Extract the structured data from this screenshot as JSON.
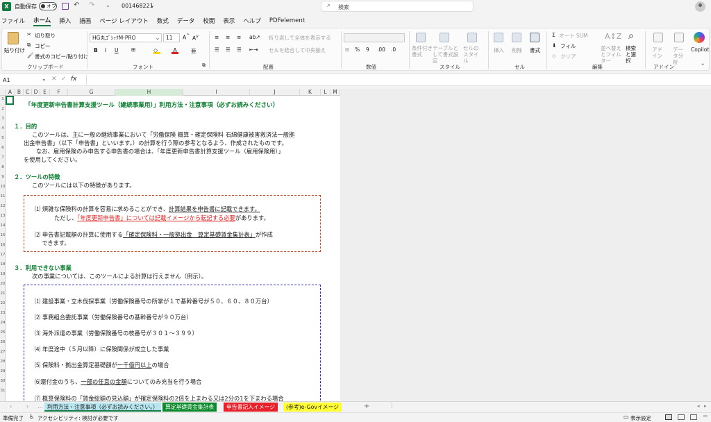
{
  "titlebar": {
    "autosave_label": "自動保存",
    "autosave_state": "オフ",
    "filename": "001468221",
    "search_placeholder": "検索"
  },
  "menu": [
    "ファイル",
    "ホーム",
    "挿入",
    "描画",
    "ページ レイアウト",
    "数式",
    "データ",
    "校閲",
    "表示",
    "ヘルプ",
    "PDFelement"
  ],
  "ribbon": {
    "clipboard": {
      "paste": "貼り付け",
      "cut": "切り取り",
      "copy": "コピー",
      "format_painter": "書式のコピー/貼り付け",
      "label": "クリップボード"
    },
    "font": {
      "name": "HG丸ｺﾞｼｯｸM-PRO",
      "size": "11",
      "label": "フォント"
    },
    "alignment": {
      "wrap": "折り返して全体を表示する",
      "merge": "セルを結合して中央揃え",
      "label": "配置"
    },
    "number": {
      "label": "数値"
    },
    "styles": {
      "cond": "条件付き書式",
      "table": "テーブルとして書式設定",
      "cell": "セルのスタイル",
      "label": "スタイル"
    },
    "cells": {
      "insert": "挿入",
      "delete": "削除",
      "format": "書式",
      "label": "セル"
    },
    "editing": {
      "autosum": "オート SUM",
      "fill": "フィル",
      "clear": "クリア",
      "sort": "並べ替えとフィルター",
      "find": "検索と選択",
      "label": "編集"
    },
    "addins": {
      "addins": "アドイン",
      "data_analysis": "データ分析",
      "copilot": "Copilot",
      "label": "アドイン"
    }
  },
  "formula_bar": {
    "name_box": "A1",
    "fx": "fx"
  },
  "columns": [
    "A",
    "B",
    "C",
    "D",
    "E",
    "F",
    "G",
    "H",
    "I",
    "J",
    "K",
    "L",
    "M"
  ],
  "sheet": {
    "title": "「年度更新申告書計算支援ツール（継続事業用）」利用方法・注意事項（必ずお読みください）",
    "sec1_title": "１．目的",
    "sec1_p1a": "このツールは、主に一般の継続事業において「労働保険 概算・確定保険料 石綿健康被害救済法一般拠",
    "sec1_p1b": "出金申告書」（以下「申告書」といいます。）の計算を行う際の参考となるよう、作成されたものです。",
    "sec1_p2a": "なお、雇用保険のみ申告する申告書の場合は、「年度更新申告書計算支援ツール（雇用保険用）」",
    "sec1_p2b": "を使用してください。",
    "sec2_title": "２．ツールの特徴",
    "sec2_intro": "このツールには以下の特徴があります。",
    "feat1_a": "⑴ 煩雑な保険料の計算を容易に求めることができ、",
    "feat1_b": "計算結果を申告書に記載できます。",
    "feat1_c": "ただし、",
    "feat1_d": "「年度更新申告書」については記載イメージから転記する必要",
    "feat1_e": "があります。",
    "feat2_a": "⑵ 申告書記載額の計算に使用する",
    "feat2_b": "「確定保険料・一般拠出金　算定基礎賃金集計表」",
    "feat2_c": "が作成",
    "feat2_d": "できます。",
    "sec3_title": "３．利用できない事業",
    "sec3_intro": "次の事業については、このツールによる計算は行えません（例示）。",
    "item1": "⑴ 建設事業・立木伐採事業（労働保険番号の所掌が１で基幹番号が５０、６０、８０万台）",
    "item2": "⑵ 事務組合委託事業（労働保険番号の基幹番号が９０万台）",
    "item3": "⑶ 海外派遣の事業（労働保険番号の枝番号が３０１～３９９）",
    "item4": "⑷ 年度途中（５月以降）に保険関係が成立した事業",
    "item5_a": "⑸ 保険料・拠出金算定基礎額が",
    "item5_b": "一千億円以上",
    "item5_c": "の場合",
    "item6_a": "⑹還付金のうち、",
    "item6_b": "一部の任意の金額",
    "item6_c": "についてのみ充当を行う場合",
    "item7": "⑺ 概算保険料の「賃金総額の見込額」が確定保険料の2倍を上まわる又は2分の1を下まわる場合"
  },
  "tabs": [
    {
      "label": "利用方法・注意事項（必ずお読みください。）",
      "color": "#b8e6f0"
    },
    {
      "label": "算定基礎賃金集計表",
      "color": "#0a8a2a"
    },
    {
      "label": "申告書記入イメージ",
      "color": "#e8202a"
    },
    {
      "label": "(参考)e-Govイメージ",
      "color": "#ffff33"
    }
  ],
  "status": {
    "ready": "準備完了",
    "accessibility": "アクセシビリティ: 検討が必要です",
    "display_settings": "表示設定"
  }
}
